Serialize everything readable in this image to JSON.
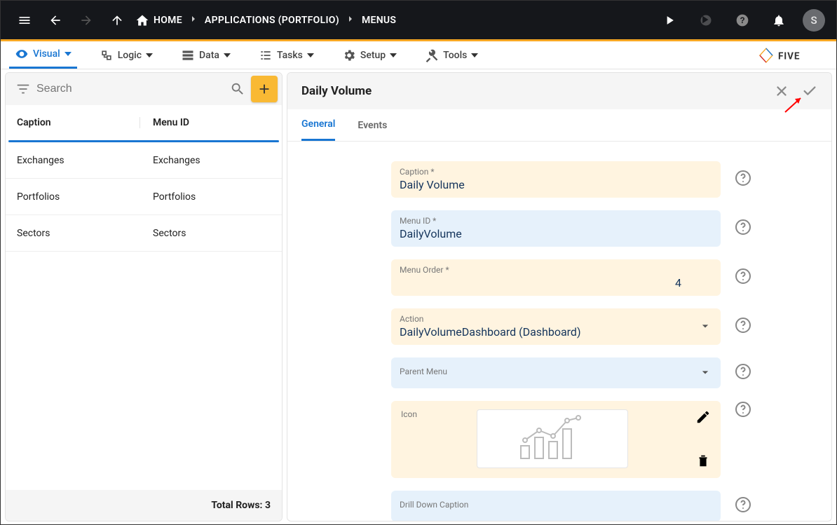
{
  "topbar": {
    "home": "HOME",
    "crumbs": [
      "APPLICATIONS (PORTFOLIO)",
      "MENUS"
    ],
    "avatar": "S"
  },
  "tabs": {
    "visual": "Visual",
    "logic": "Logic",
    "data": "Data",
    "tasks": "Tasks",
    "setup": "Setup",
    "tools": "Tools",
    "brand": "FIVE"
  },
  "left": {
    "search_placeholder": "Search",
    "headers": {
      "caption": "Caption",
      "menuid": "Menu ID"
    },
    "rows": [
      {
        "caption": "Exchanges",
        "menuid": "Exchanges"
      },
      {
        "caption": "Portfolios",
        "menuid": "Portfolios"
      },
      {
        "caption": "Sectors",
        "menuid": "Sectors"
      }
    ],
    "totals": "Total Rows: 3"
  },
  "right": {
    "title": "Daily Volume",
    "subtabs": {
      "general": "General",
      "events": "Events"
    },
    "fields": {
      "caption_label": "Caption *",
      "caption_value": "Daily Volume",
      "menuid_label": "Menu ID *",
      "menuid_value": "DailyVolume",
      "order_label": "Menu Order *",
      "order_value": "4",
      "action_label": "Action",
      "action_value": "DailyVolumeDashboard (Dashboard)",
      "parent_label": "Parent Menu",
      "parent_value": "",
      "icon_label": "Icon",
      "drilldown_label": "Drill Down Caption",
      "drilldown_value": ""
    }
  }
}
